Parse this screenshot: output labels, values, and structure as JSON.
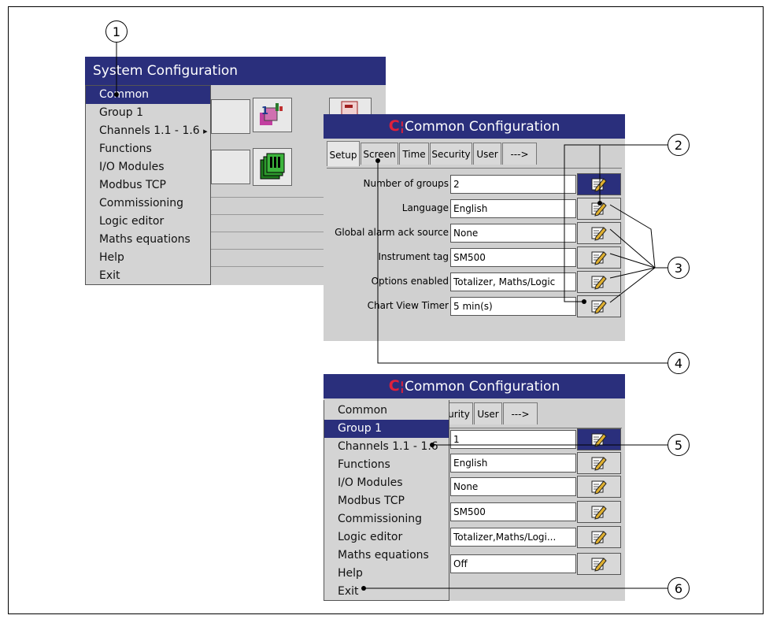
{
  "callouts": [
    "1",
    "2",
    "3",
    "4",
    "5",
    "6"
  ],
  "system_config": {
    "title": "System Configuration",
    "menu": [
      "Common",
      "Group 1",
      "Channels 1.1 - 1.6",
      "Functions",
      "I/O Modules",
      "Modbus TCP",
      "Commissioning",
      "Logic editor",
      "Maths equations",
      "Help",
      "Exit"
    ],
    "selected_index": 0,
    "submenu_arrow": "▸"
  },
  "common_config_top": {
    "title": "Common Configuration",
    "logo_text": "C",
    "tabs": [
      "Setup",
      "Screen",
      "Time",
      "Security",
      "User",
      "--->"
    ],
    "active_tab": "Setup",
    "rows": [
      {
        "label": "Number of groups",
        "value": "2"
      },
      {
        "label": "Language",
        "value": "English"
      },
      {
        "label": "Global alarm ack source",
        "value": "None"
      },
      {
        "label": "Instrument tag",
        "value": "SM500"
      },
      {
        "label": "Options enabled",
        "value": "Totalizer, Maths/Logic"
      },
      {
        "label": "Chart View Timer",
        "value": "5 min(s)"
      }
    ]
  },
  "common_config_bottom": {
    "title": "Common Configuration",
    "logo_text": "C",
    "tabs_visible": [
      "urity",
      "User",
      "--->"
    ],
    "menu": [
      "Common",
      "Group 1",
      "Channels 1.1 - 1.6",
      "Functions",
      "I/O Modules",
      "Modbus TCP",
      "Commissioning",
      "Logic editor",
      "Maths equations",
      "Help",
      "Exit"
    ],
    "selected_index": 1,
    "values": [
      "1",
      "English",
      "None",
      "SM500",
      "Totalizer,Maths/Logi...",
      "Off"
    ]
  },
  "icons": {
    "edit": "edit-pencil-icon",
    "logo": "brand-logo-icon"
  },
  "colors": {
    "titlebar": "#2a2f7c",
    "highlight": "#2a2f7c",
    "logo_red": "#c8102e",
    "panel": "#d0d0d0"
  }
}
